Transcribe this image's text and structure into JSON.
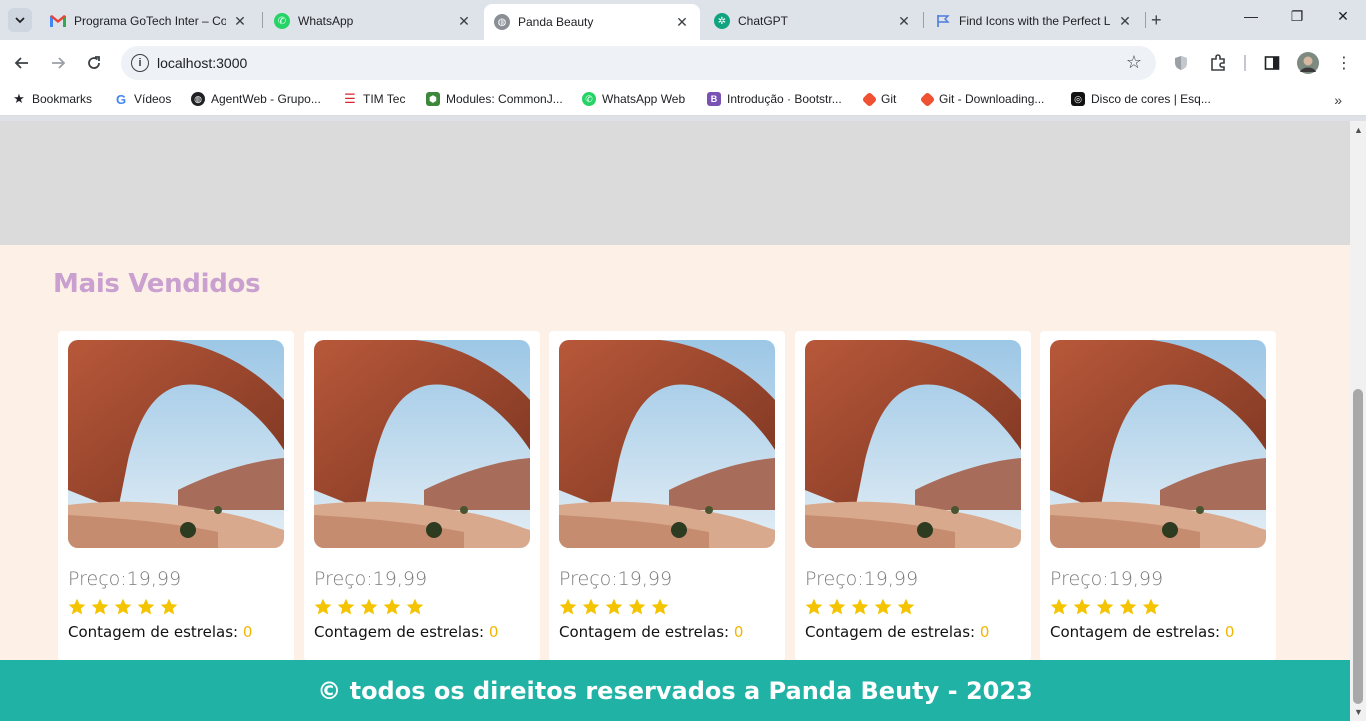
{
  "browser": {
    "tabs": [
      {
        "title": "Programa GoTech Inter – Co",
        "icon": "gmail-icon",
        "color": "#ea4335"
      },
      {
        "title": "WhatsApp",
        "icon": "whatsapp-icon",
        "color": "#25d366"
      },
      {
        "title": "Panda Beauty",
        "icon": "globe-icon",
        "color": "#5f6368",
        "active": true
      },
      {
        "title": "ChatGPT",
        "icon": "chatgpt-icon",
        "color": "#10a37f"
      },
      {
        "title": "Find Icons with the Perfect L",
        "icon": "flag-icon",
        "color": "#4c7bd9"
      }
    ],
    "url": "localhost:3000",
    "bookmarks": [
      {
        "label": "Bookmarks",
        "icon": "star-icon"
      },
      {
        "label": "Vídeos",
        "icon": "google-icon"
      },
      {
        "label": "AgentWeb - Grupo...",
        "icon": "globe-icon"
      },
      {
        "label": "TIM Tec",
        "icon": "timtec-icon"
      },
      {
        "label": "Modules: CommonJ...",
        "icon": "nodejs-icon"
      },
      {
        "label": "WhatsApp Web",
        "icon": "whatsapp-icon"
      },
      {
        "label": "Introdução · Bootstr...",
        "icon": "bootstrap-icon"
      },
      {
        "label": "Git",
        "icon": "git-icon"
      },
      {
        "label": "Git - Downloading...",
        "icon": "git-icon"
      },
      {
        "label": "Disco de cores | Esq...",
        "icon": "color-wheel-icon"
      }
    ]
  },
  "page": {
    "section_title": "Mais Vendidos",
    "products": [
      {
        "price_label": "Preço:19,99",
        "rating_stars": 5,
        "count_label": "Contagem de estrelas: ",
        "count_value": "0"
      },
      {
        "price_label": "Preço:19,99",
        "rating_stars": 5,
        "count_label": "Contagem de estrelas: ",
        "count_value": "0"
      },
      {
        "price_label": "Preço:19,99",
        "rating_stars": 5,
        "count_label": "Contagem de estrelas: ",
        "count_value": "0"
      },
      {
        "price_label": "Preço:19,99",
        "rating_stars": 5,
        "count_label": "Contagem de estrelas: ",
        "count_value": "0"
      },
      {
        "price_label": "Preço:19,99",
        "rating_stars": 5,
        "count_label": "Contagem de estrelas: ",
        "count_value": "0"
      }
    ],
    "footer_text": "© todos os direitos reservados a Panda Beuty - 2023",
    "colors": {
      "title": "#c9a0cf",
      "footer": "#21b2a6",
      "star": "#f5c400",
      "background": "#fcf0e7"
    }
  }
}
